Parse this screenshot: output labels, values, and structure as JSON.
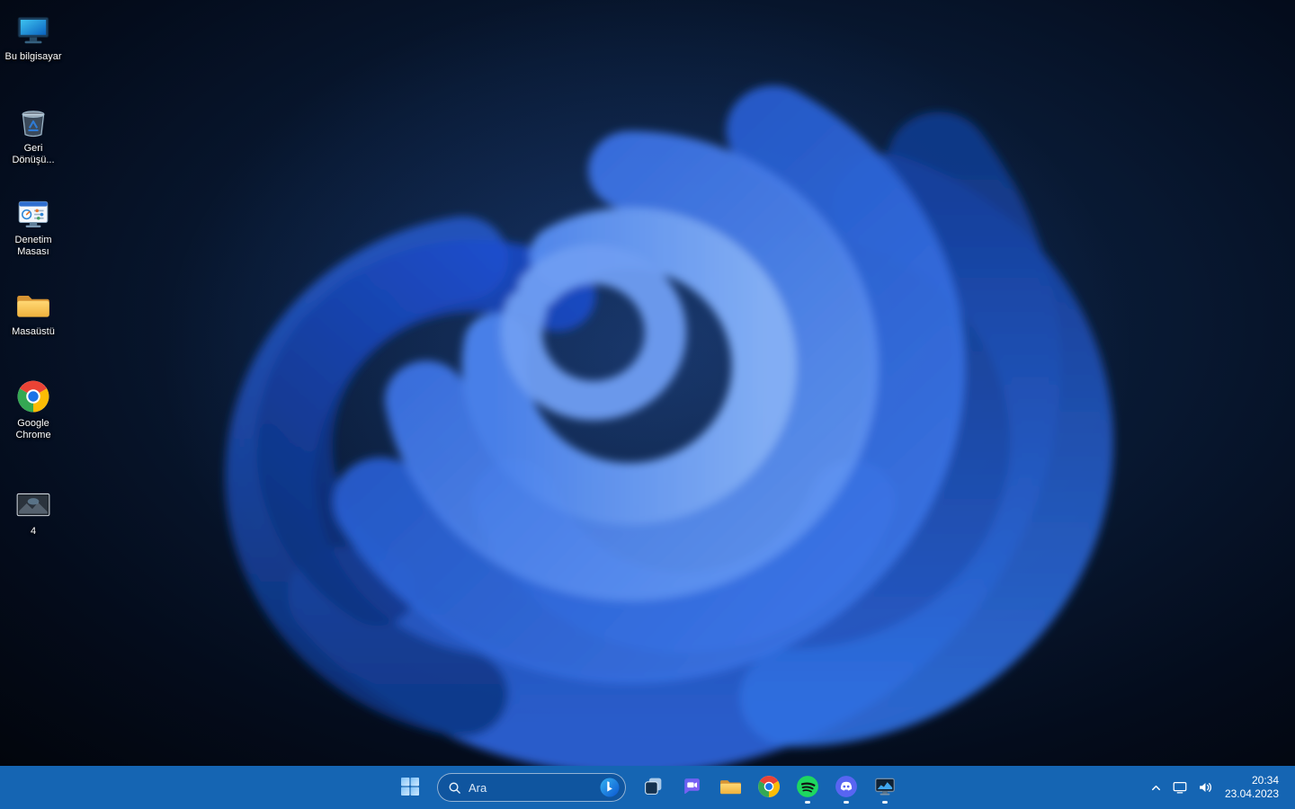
{
  "desktop": {
    "icons": [
      {
        "id": "this-pc",
        "label": "Bu bilgisayar"
      },
      {
        "id": "recycle-bin",
        "label": "Geri Dönüşü..."
      },
      {
        "id": "control-panel",
        "label": "Denetim Masası"
      },
      {
        "id": "desktop-folder",
        "label": "Masaüstü"
      },
      {
        "id": "chrome",
        "label": "Google Chrome"
      },
      {
        "id": "image-file",
        "label": "4"
      }
    ]
  },
  "taskbar": {
    "search_placeholder": "Ara",
    "apps": [
      {
        "id": "start",
        "icon": "windows-logo-icon"
      },
      {
        "id": "task-view",
        "icon": "task-view-icon"
      },
      {
        "id": "chat",
        "icon": "chat-icon"
      },
      {
        "id": "file-explorer",
        "icon": "folder-icon"
      },
      {
        "id": "chrome",
        "icon": "chrome-icon"
      },
      {
        "id": "spotify",
        "icon": "spotify-icon",
        "running": true
      },
      {
        "id": "discord",
        "icon": "discord-icon",
        "running": true
      },
      {
        "id": "system-monitor",
        "icon": "monitor-chart-icon",
        "running": true
      }
    ],
    "tray": {
      "time": "20:34",
      "date": "23.04.2023",
      "icons": [
        "chevron-up-icon",
        "display-network-icon",
        "volume-icon"
      ]
    }
  },
  "colors": {
    "taskbar": "#1565b3",
    "search_pill": "#0f559f",
    "wallpaper_accent": "#2f6fe0",
    "background_dark": "#04070d"
  }
}
